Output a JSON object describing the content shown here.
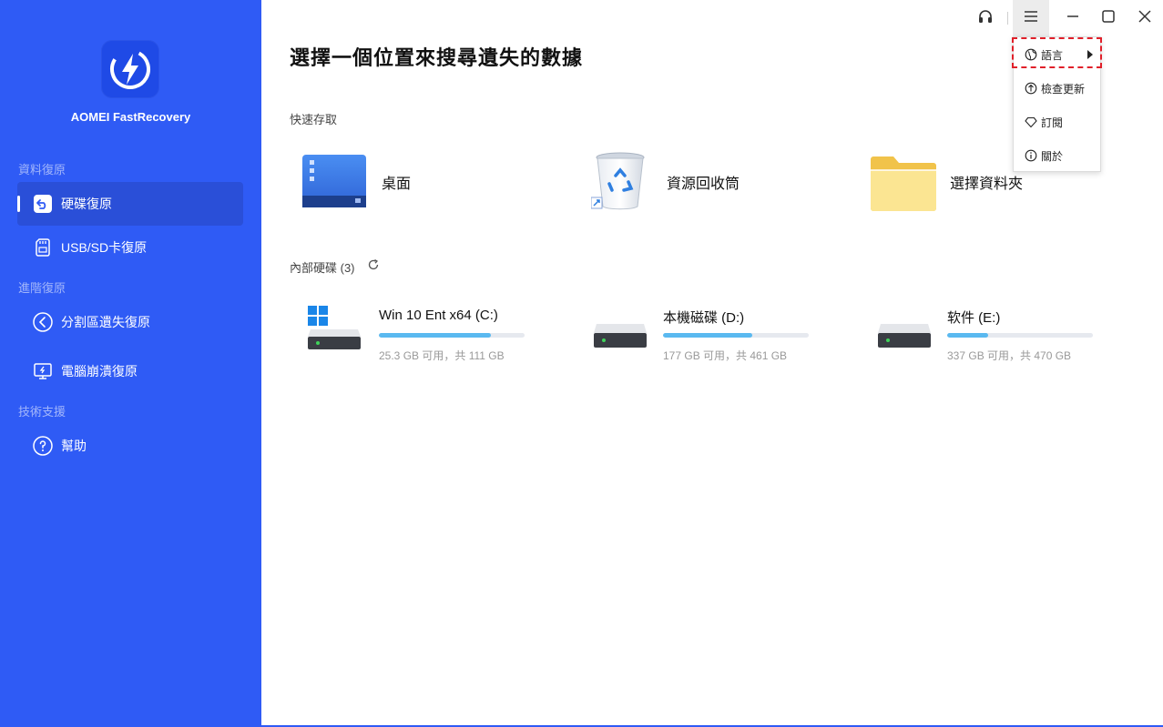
{
  "app": {
    "name": "AOMEI FastRecovery"
  },
  "colors": {
    "sidebar_bg": "#2f5bf5",
    "active_item_bg": "#2a4fd8",
    "progress_fill": "#5ab9f0",
    "highlight": "#e0202a"
  },
  "sidebar": {
    "sections": [
      {
        "label": "資料復原"
      },
      {
        "label": "進階復原"
      },
      {
        "label": "技術支援"
      }
    ],
    "items": [
      {
        "label": "硬碟復原",
        "icon": "restore-icon",
        "active": true
      },
      {
        "label": "USB/SD卡復原",
        "icon": "sd-card-icon",
        "active": false
      },
      {
        "label": "分割區遺失復原",
        "icon": "partition-icon",
        "active": false
      },
      {
        "label": "電腦崩潰復原",
        "icon": "monitor-crash-icon",
        "active": false
      },
      {
        "label": "幫助",
        "icon": "help-icon",
        "active": false
      }
    ]
  },
  "main": {
    "title": "選擇一個位置來搜尋遺失的數據",
    "quick_access": {
      "label": "快速存取",
      "items": [
        {
          "label": "桌面",
          "icon": "desktop-icon"
        },
        {
          "label": "資源回收筒",
          "icon": "recycle-bin-icon"
        },
        {
          "label": "選擇資料夾",
          "icon": "folder-icon"
        }
      ]
    },
    "drives": {
      "label": "內部硬碟 (3)",
      "items": [
        {
          "name": "Win 10 Ent x64 (C:)",
          "size_text": "25.3 GB 可用，共 111 GB",
          "used_fraction": 0.77,
          "os": true
        },
        {
          "name": "本機磁碟 (D:)",
          "size_text": "177 GB 可用，共 461 GB",
          "used_fraction": 0.61,
          "os": false
        },
        {
          "name": "软件 (E:)",
          "size_text": "337 GB 可用，共 470 GB",
          "used_fraction": 0.28,
          "os": false
        }
      ]
    }
  },
  "menu": {
    "items": [
      {
        "label": "語言",
        "icon": "globe-icon",
        "submenu": true
      },
      {
        "label": "檢查更新",
        "icon": "update-icon",
        "submenu": false
      },
      {
        "label": "訂閱",
        "icon": "diamond-icon",
        "submenu": false
      },
      {
        "label": "關於",
        "icon": "info-icon",
        "submenu": false
      }
    ]
  }
}
